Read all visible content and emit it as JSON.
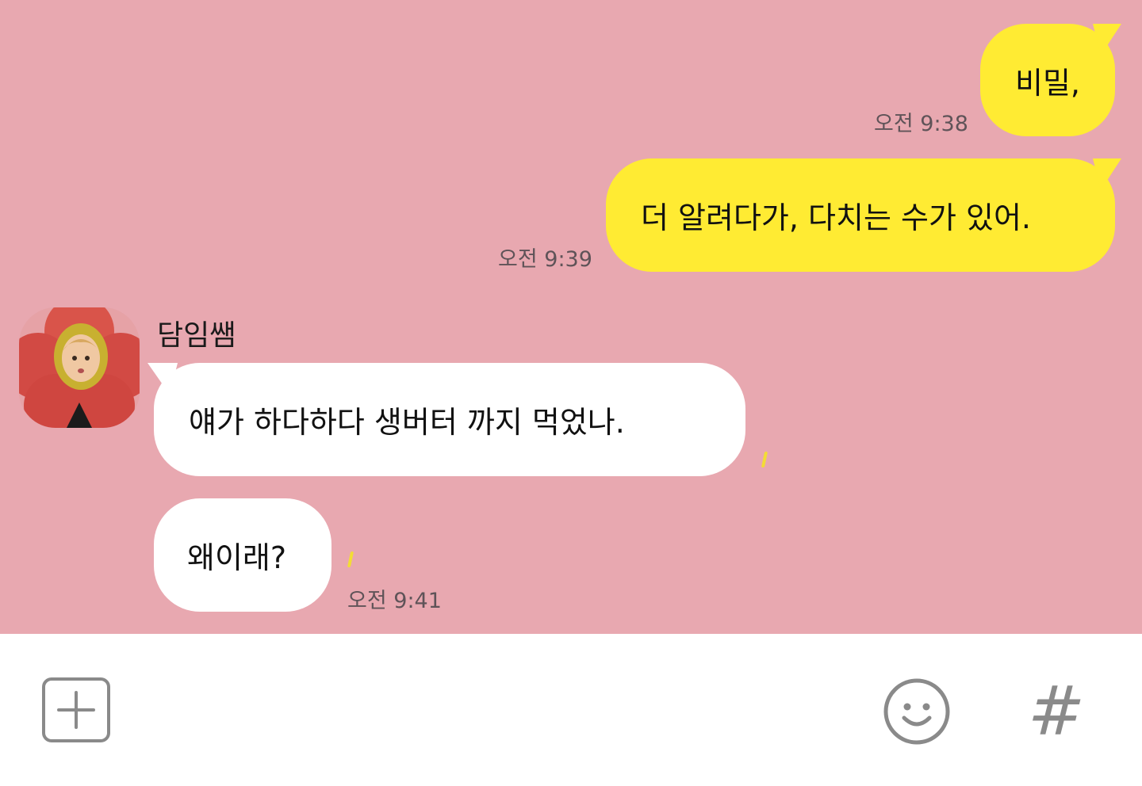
{
  "colors": {
    "chat_background": "#e8a8b0",
    "my_bubble": "#ffeb33",
    "their_bubble": "#ffffff",
    "read_marker": "#f3dc35",
    "icon_gray": "#8a8a8a"
  },
  "messages": [
    {
      "sender": "me",
      "text": "비밀,",
      "time": "오전 9:38"
    },
    {
      "sender": "me",
      "text": "더 알려다가, 다치는 수가 있어.",
      "time": "오전 9:39"
    },
    {
      "sender": "them",
      "sender_name": "담임쌤",
      "text": "얘가 하다하다 생버터 까지 먹었나.",
      "time": ""
    },
    {
      "sender": "them",
      "text": "왜이래?",
      "time": "오전 9:41"
    }
  ],
  "input_bar": {
    "left_icon": "plus-square-icon",
    "right_icons": [
      "emoji-smile-icon",
      "hashtag-icon"
    ],
    "hashtag_glyph": "#"
  }
}
